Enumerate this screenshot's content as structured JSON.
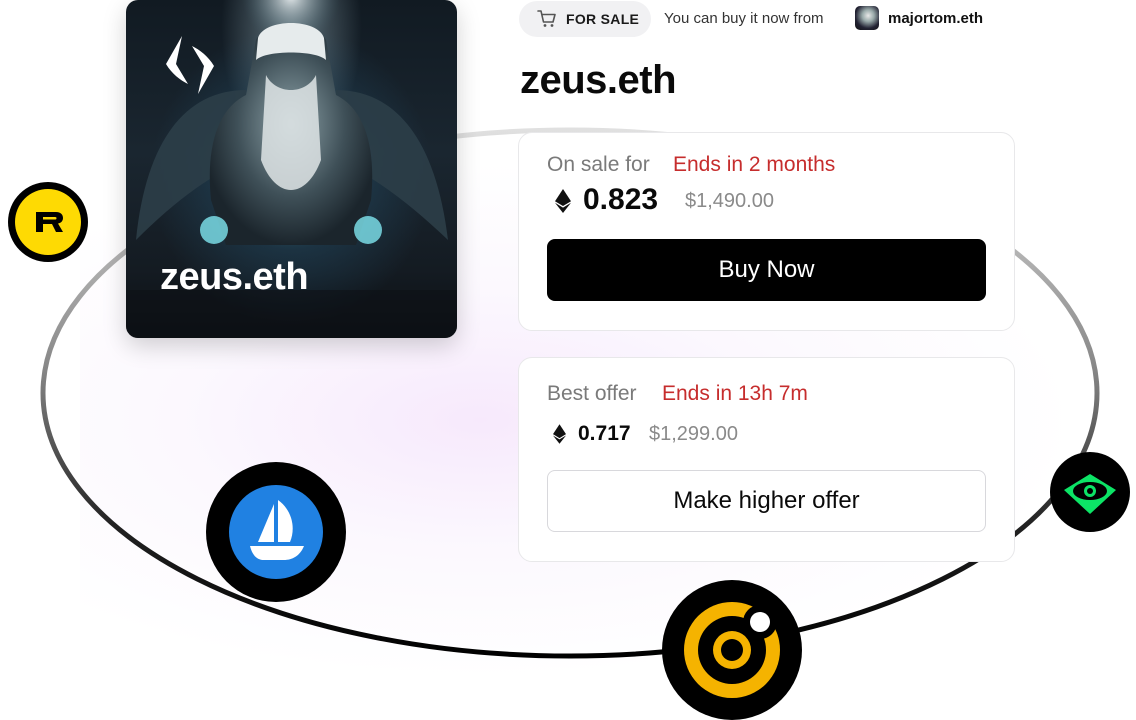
{
  "badge": {
    "label": "FOR SALE",
    "icon": "cart-icon"
  },
  "seller": {
    "prefix": "You can buy it now from",
    "name": "majortom.eth"
  },
  "title": "zeus.eth",
  "nft_card": {
    "name": "zeus.eth",
    "logo": "ens-logo"
  },
  "sale": {
    "label": "On sale for",
    "ends": "Ends in 2 months",
    "price_eth": "0.823",
    "price_usd": "$1,490.00",
    "button": "Buy Now"
  },
  "offer": {
    "label": "Best offer",
    "ends": "Ends in 13h 7m",
    "price_eth": "0.717",
    "price_usd": "$1,299.00",
    "button": "Make higher offer"
  },
  "marketplaces": [
    {
      "name": "rarible-icon",
      "color": "#FEDA03"
    },
    {
      "name": "opensea-icon",
      "color": "#2081E2"
    },
    {
      "name": "coinbase-nft-icon",
      "color": "#F5B300"
    },
    {
      "name": "looksrare-icon",
      "color": "#0CE466"
    }
  ],
  "colors": {
    "accent_red": "#c62d2d",
    "button_black": "#000000"
  }
}
